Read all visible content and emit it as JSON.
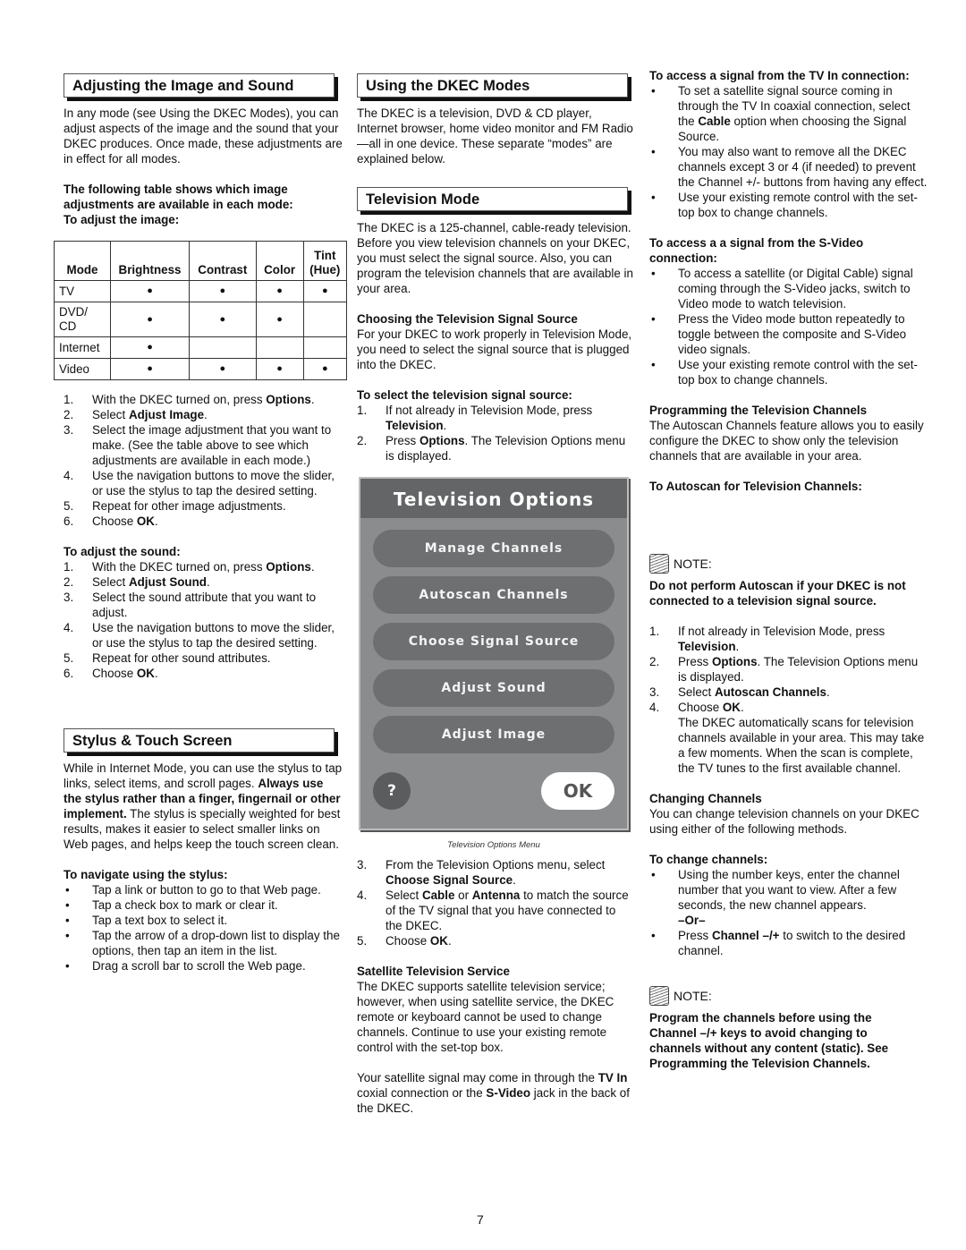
{
  "page_number": "7",
  "col1": {
    "heading1": "Adjusting the Image and Sound",
    "intro": "In any mode (see Using the DKEC Modes), you can adjust aspects of the image and the sound that your DKEC produces. Once made, these adjustments are in effect for all modes.",
    "table_intro": "The following table shows which image adjustments are available in each mode:",
    "to_adjust_image": "To adjust the image:",
    "table": {
      "headers": [
        "Mode",
        "Brightness",
        "Contrast",
        "Color",
        "Tint (Hue)"
      ],
      "rows": [
        {
          "mode": "TV",
          "cells": [
            "●",
            "●",
            "●",
            "●"
          ]
        },
        {
          "mode": "DVD/ CD",
          "cells": [
            "●",
            "●",
            "●",
            ""
          ]
        },
        {
          "mode": "Internet",
          "cells": [
            "●",
            "",
            "",
            ""
          ]
        },
        {
          "mode": "Video",
          "cells": [
            "●",
            "●",
            "●",
            "●"
          ]
        }
      ]
    },
    "image_steps": [
      {
        "n": "1.",
        "pre": "With the DKEC turned on, press ",
        "bold": "Options",
        "post": "."
      },
      {
        "n": "2.",
        "pre": "Select ",
        "bold": "Adjust Image",
        "post": "."
      },
      {
        "n": "3.",
        "pre": "Select the image adjustment that you want to make. (See the table above to see which adjustments are available in each mode.)",
        "bold": "",
        "post": ""
      },
      {
        "n": "4.",
        "pre": "Use the navigation buttons to move the slider, or use the stylus to tap the desired setting.",
        "bold": "",
        "post": ""
      },
      {
        "n": "5.",
        "pre": "Repeat for other image adjustments.",
        "bold": "",
        "post": ""
      },
      {
        "n": "6.",
        "pre": "Choose ",
        "bold": "OK",
        "post": "."
      }
    ],
    "to_adjust_sound": "To adjust the sound:",
    "sound_steps": [
      {
        "n": "1.",
        "pre": "With the DKEC turned on, press ",
        "bold": "Options",
        "post": "."
      },
      {
        "n": "2.",
        "pre": "Select ",
        "bold": "Adjust Sound",
        "post": "."
      },
      {
        "n": "3.",
        "pre": "Select the sound attribute that you want to adjust.",
        "bold": "",
        "post": ""
      },
      {
        "n": "4.",
        "pre": "Use the navigation buttons to move the slider, or use the stylus to tap the desired setting.",
        "bold": "",
        "post": ""
      },
      {
        "n": "5.",
        "pre": "Repeat for other sound attributes.",
        "bold": "",
        "post": ""
      },
      {
        "n": "6.",
        "pre": "Choose ",
        "bold": "OK",
        "post": "."
      }
    ],
    "heading2": "Stylus & Touch Screen",
    "stylus_p1": "While in Internet Mode, you can use the stylus to tap links, select items, and scroll pages. ",
    "stylus_bold": "Always use the stylus rather than a finger, fingernail or other implement.",
    "stylus_p2": " The stylus is specially weighted for best results, makes it easier to select smaller links on Web pages, and helps keep the touch screen clean.",
    "navigate_title": "To navigate using the stylus:",
    "navigate_bullets": [
      "Tap a link or button to go to that Web page.",
      "Tap a check box to mark or clear it.",
      "Tap a text box to select it.",
      "Tap the arrow of a drop-down list to display the options, then tap an item in the list.",
      "Drag a scroll bar to scroll the Web page."
    ]
  },
  "col2": {
    "heading1": "Using the DKEC Modes",
    "modes_text": "The DKEC is a television, DVD & CD player, Internet browser, home video monitor and FM Radio—all in one device. These separate “modes” are explained below.",
    "heading2": "Television Mode",
    "tv_text": "The DKEC is a 125-channel, cable-ready television. Before you view television channels on your DKEC, you must select the signal source. Also, you can program the television channels that are available in your area.",
    "choosing_title": "Choosing the Television Signal Source",
    "choosing_text": "For your DKEC to work properly in Television Mode, you need to select the signal source that is plugged into the DKEC.",
    "select_title": "To select the television signal source:",
    "select_steps_a": [
      {
        "n": "1.",
        "pre": "If not already in Television Mode, press ",
        "bold": "Television",
        "post": "."
      },
      {
        "n": "2.",
        "pre": "Press ",
        "bold": "Options",
        "post": ". The Television Options menu is displayed."
      }
    ],
    "tv_menu": {
      "title": "Television Options",
      "buttons": [
        "Manage Channels",
        "Autoscan Channels",
        "Choose Signal Source",
        "Adjust Sound",
        "Adjust Image"
      ],
      "help_label": "?",
      "ok_label": "OK",
      "caption": "Television Options Menu",
      "colors": {
        "panel": "#8a8c8e",
        "title_bar": "#636567",
        "button": "#6d6f71",
        "ok": "#ffffff"
      }
    },
    "select_steps_b": [
      {
        "n": "3.",
        "pre": "From the Television Options menu, select ",
        "bold": "Choose Signal Source",
        "post": "."
      },
      {
        "n": "4.",
        "pre": "Select ",
        "bold": "Cable",
        "mid": " or ",
        "bold2": "Antenna",
        "post": " to match the source of the TV signal that you have connected to the DKEC."
      },
      {
        "n": "5.",
        "pre": "Choose ",
        "bold": "OK",
        "post": "."
      }
    ],
    "satellite_title": "Satellite Television Service",
    "satellite_text": "The DKEC supports satellite television service; however, when using satellite service, the DKEC remote or keyboard cannot be used to change channels. Continue to use your existing remote control with the set-top box.",
    "satellite_p2_a": "Your satellite signal may come in through the ",
    "satellite_p2_b1": "TV In",
    "satellite_p2_c": " coxial connection or the ",
    "satellite_p2_b2": "S-Video",
    "satellite_p2_d": " jack in the back of the DKEC."
  },
  "col3": {
    "tvin_title": "To access a signal from the TV In connection:",
    "tvin_bullets": [
      {
        "pre": "To set a satellite signal source coming in through the TV In coaxial connection, select the ",
        "bold": "Cable",
        "post": " option when choosing the Signal Source."
      },
      {
        "pre": "You may also want to remove all the DKEC channels except 3 or 4 (if needed) to prevent the Channel +/- buttons from having any effect.",
        "bold": "",
        "post": ""
      },
      {
        "pre": "Use your existing remote control with the set-top box to change channels.",
        "bold": "",
        "post": ""
      }
    ],
    "svideo_title": "To access a a signal from the S-Video connection:",
    "svideo_bullets": [
      "To access a satellite (or Digital Cable) signal coming through the S-Video jacks, switch to Video mode to watch television.",
      "Press the Video mode button repeatedly to toggle between the composite and S-Video video signals.",
      "Use your existing remote control with the set-top box to change channels."
    ],
    "programming_title": "Programming the Television Channels",
    "programming_text": "The Autoscan Channels feature allows you to easily configure the DKEC to show only the television channels that are available in your area.",
    "autoscan_title": "To Autoscan for Television Channels:",
    "note_label": "NOTE:",
    "note1_text": "Do not perform Autoscan if your DKEC is not connected to a television signal source.",
    "autoscan_steps": [
      {
        "n": "1.",
        "pre": "If not already in Television Mode, press ",
        "bold": "Television",
        "post": "."
      },
      {
        "n": "2.",
        "pre": "Press ",
        "bold": "Options",
        "post": ". The Television Options menu is displayed."
      },
      {
        "n": "3.",
        "pre": "Select ",
        "bold": "Autoscan Channels",
        "post": "."
      },
      {
        "n": "4.",
        "pre": "Choose ",
        "bold": "OK",
        "post": "."
      }
    ],
    "autoscan_result": "The DKEC automatically scans for television channels available in your area. This may take a few moments. When the scan is complete, the TV tunes to the first available channel.",
    "changing_title": "Changing Channels",
    "changing_text": "You can change television channels on your DKEC using either of the following methods.",
    "change_title": "To change channels:",
    "change_bullet1": "Using the number keys, enter the channel number that you want to view. After a few seconds, the new channel appears.",
    "or_label": "–Or–",
    "change_bullet2_pre": "Press ",
    "change_bullet2_bold": "Channel –/+",
    "change_bullet2_post": " to switch to the desired channel.",
    "note2_text": "Program the channels before using the Channel –/+ keys to avoid changing to channels without any content (static). See Programming the Television Channels."
  }
}
